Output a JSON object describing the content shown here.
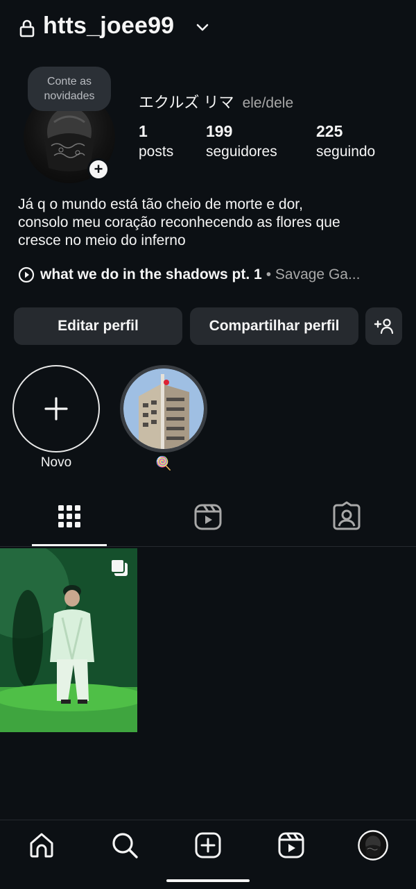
{
  "header": {
    "username": "htts_joee99"
  },
  "profile": {
    "note_bubble": "Conte as novidades",
    "display_name": "エクルズ リマ",
    "pronouns": "ele/dele",
    "stats": [
      {
        "value": "1",
        "label": "posts"
      },
      {
        "value": "199",
        "label": "seguidores"
      },
      {
        "value": "225",
        "label": "seguindo"
      }
    ],
    "bio_lines": [
      "Já q o mundo está tão cheio de morte e dor,",
      "consolo meu coração reconhecendo as flores que",
      "cresce no meio do inferno"
    ],
    "music": {
      "title": "what we do in the shadows pt. 1",
      "artist": "• Savage Ga..."
    }
  },
  "actions": {
    "edit": "Editar perfil",
    "share": "Compartilhar perfil"
  },
  "highlights": [
    {
      "label": "Novo"
    },
    {
      "label": "🍭"
    }
  ],
  "tabs": [
    "grid-icon",
    "reels-icon",
    "tagged-icon"
  ],
  "nav": [
    "home-icon",
    "search-icon",
    "create-icon",
    "reels-icon",
    "profile-avatar"
  ],
  "colors": {
    "background": "#0c1014",
    "button": "#262a2f",
    "text": "#f5f5f5",
    "muted": "#a8a8a8"
  }
}
